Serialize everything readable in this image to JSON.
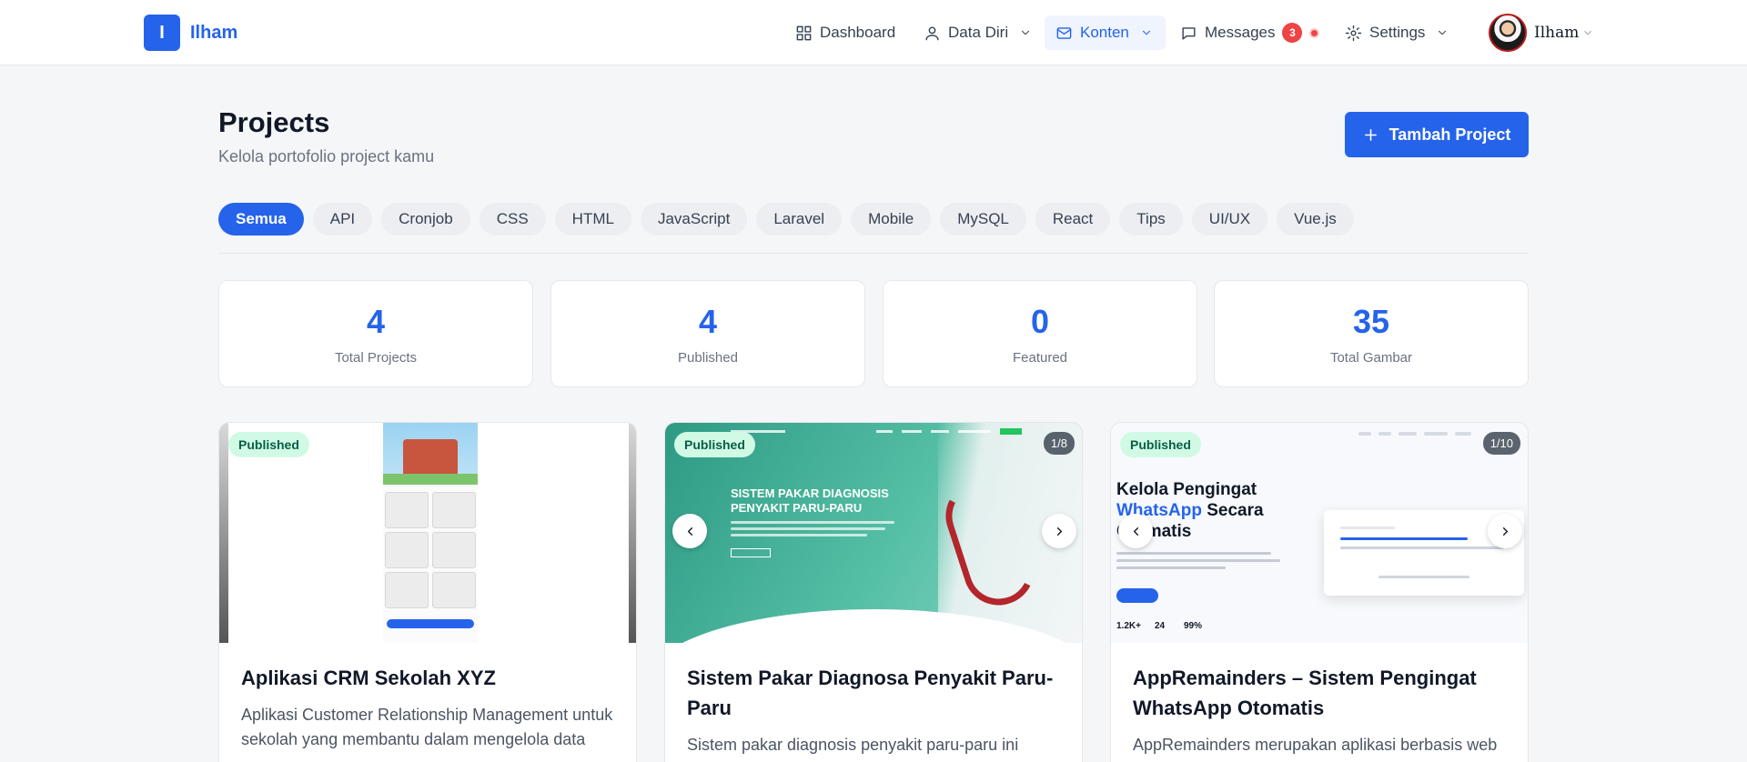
{
  "brand": {
    "logo_letter": "I",
    "name": "Ilham"
  },
  "nav": {
    "dashboard": "Dashboard",
    "data_diri": "Data Diri",
    "konten": "Konten",
    "messages": "Messages",
    "messages_count": "3",
    "settings": "Settings",
    "user_name": "Ilham"
  },
  "header": {
    "title": "Projects",
    "subtitle": "Kelola portofolio project kamu",
    "add_button": "Tambah Project"
  },
  "filters": [
    "Semua",
    "API",
    "Cronjob",
    "CSS",
    "HTML",
    "JavaScript",
    "Laravel",
    "Mobile",
    "MySQL",
    "React",
    "Tips",
    "UI/UX",
    "Vue.js"
  ],
  "active_filter": "Semua",
  "stats": [
    {
      "value": "4",
      "label": "Total Projects"
    },
    {
      "value": "4",
      "label": "Published"
    },
    {
      "value": "0",
      "label": "Featured"
    },
    {
      "value": "35",
      "label": "Total Gambar"
    }
  ],
  "projects": [
    {
      "status": "Published",
      "counter": "",
      "title": "Aplikasi CRM Sekolah XYZ",
      "description": "Aplikasi Customer Relationship Management untuk sekolah yang membantu dalam mengelola data"
    },
    {
      "status": "Published",
      "counter": "1/8",
      "title": "Sistem Pakar Diagnosa Penyakit Paru-Paru",
      "description": "Sistem pakar diagnosis penyakit paru-paru ini",
      "thumb_heading": "SISTEM PAKAR DIAGNOSIS PENYAKIT PARU-PARU"
    },
    {
      "status": "Published",
      "counter": "1/10",
      "title": "AppRemainders – Sistem Pengingat WhatsApp Otomatis",
      "description": "AppRemainders merupakan aplikasi berbasis web",
      "thumb_heading_a": "Kelola Pengingat",
      "thumb_heading_b": "WhatsApp",
      "thumb_heading_c": "Secara Otomatis",
      "thumb_stats": [
        "1.2K+",
        "24",
        "99%"
      ]
    }
  ],
  "colors": {
    "primary": "#2563eb",
    "published_bg": "#d1fae5",
    "badge": "#ef4444"
  }
}
